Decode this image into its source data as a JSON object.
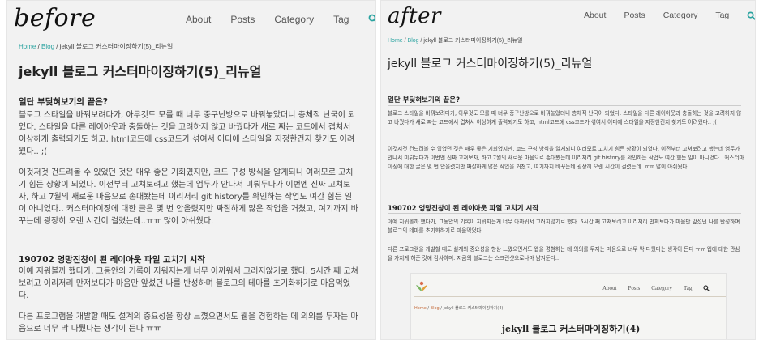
{
  "before": {
    "label": "before",
    "nav": [
      "About",
      "Posts",
      "Category",
      "Tag"
    ],
    "breadcrumb": {
      "home": "Home",
      "sep1": " / ",
      "blog": "Blog",
      "sep2": " / ",
      "current": "jekyll 블로그 커스터마이징하기(5)_리뉴얼"
    },
    "title": "jekyll 블로그 커스터마이징하기(5)_리뉴얼",
    "section1_heading": "일단 부딪혀보기의 끝은?",
    "para1": "블로그 스타일을 바꿔보려다가, 아무것도 모를 때 너무 중구난방으로 바꿔놓았더니 총체적 난국이 되었다. 스타일을 다른 레이아웃과 충돌하는 것을 고려하지 않고 바꿨다가 새로 짜는 코드에서 겹쳐서 이상하게 출력되기도 하고, html코드에 css코드가 섞여서 어디에 스타일을 지정한건지 찾기도 어려웠다.. ;(",
    "para2": "이것저것 건드려볼 수 있었던 것은 매우 좋은 기회였지만, 코드 구성 방식을 알게되니 여러모로 고치기 힘든 상황이 되었다. 이전부터 고쳐보려고 했는데 엄두가 안나서 미뤄두다가 이번엔 진짜 고쳐보자, 하고 7월의 새로운 마음으로 손대봤는데 이리저리 git history를 확인하는 작업도 여간 힘든 일이 아니었다.. 커스터마이징에 대한 글은 몇 번 안올렸지만 짜잘하게 많은 작업을 거쳤고, 여기까지 바꾸는데 굉장히 오랜 시간이 걸렸는데..ㅠㅠ 많이 아쉬웠다.",
    "section2_heading": "190702 엉망진창이 된 레이아웃 파일 고치기 시작",
    "para3": "아예 지워볼까 했다가, 그동안의 기록이 지워지는게 너무 아까워서 그러지않기로 했다. 5시간 째 고쳐보려고 이리저리 만져보다가 마음만 앞섰던 나를 반성하며 블로그의 테마를 초기화하기로 마음먹었다.",
    "para4": "다른 프로그램을 개발할 때도 설계의 중요성을 항상 느꼈으면서도 웹을 경험하는 데 의의를 두자는 마음으로 너무 막 다뤘다는 생각이 든다 ㅠㅠ"
  },
  "after": {
    "label": "after",
    "nav": [
      "About",
      "Posts",
      "Category",
      "Tag"
    ],
    "breadcrumb": {
      "home": "Home",
      "sep1": " / ",
      "blog": "Blog",
      "sep2": " / ",
      "current": "jekyll 블로그 커스터마이징하기(5)_리뉴얼"
    },
    "title": "jekyll 블로그 커스터마이징하기(5)_리뉴얼",
    "section1_heading": "일단 부딪혀보기의 끝은?",
    "para1": "블로그 스타일을 바꿔보려다가, 아무것도 모를 때 너무 중구난방으로 바꿔놓았더니 총체적 난국이 되었다. 스타일을 다른 레이아웃과 충돌하는 것을 고려하지 않고 바꿨다가 새로 짜는 코드에서 겹쳐서 이상하게 출력되기도 하고, html코드에 css코드가 섞여서 어디에 스타일을 지정한건지 찾기도 어려웠다.. ;(",
    "para2": "이것저것 건드려볼 수 있었던 것은 매우 좋은 기회였지만, 코드 구성 방식을 알게되니 여러모로 고치기 힘든 상황이 되었다. 이전부터 고쳐보려고 했는데 엄두가 안나서 미뤄두다가 이번엔 진짜 고쳐보자, 하고 7월의 새로운 마음으로 손대봤는데 이리저리 git history를 확인하는 작업도 여간 힘든 일이 아니었다.. 커스터마이징에 대한 글은 몇 번 안올렸지만 짜잘하게 많은 작업을 거쳤고, 여기까지 바꾸는데 굉장히 오랜 시간이 걸렸는데..ㅠㅠ 많이 아쉬웠다.",
    "section2_heading": "190702 엉망진창이 된 레이아웃 파일 고치기 시작",
    "para3": "아예 지워볼까 했다가, 그동안의 기록이 지워지는게 너무 아까워서 그러지않기로 했다. 5시간 째 고쳐보려고 이리저리 만져보다가 마음만 앞섰던 나를 반성하며 블로그의 테마를 초기화하기로 마음먹었다.",
    "para4": "다른 프로그램을 개발할 때도 설계의 중요성을 항상 느꼈으면서도 웹을 경험하는 데 의의를 두자는 마음으로 너무 막 다뤘다는 생각이 든다 ㅠㅠ 웹에 대한 관심을 가지게 해준 것에 감사하며. 지금의 블로그는 스크린샷으로나마 남겨둔다..",
    "embed": {
      "nav": [
        "About",
        "Posts",
        "Category",
        "Tag"
      ],
      "breadcrumb": {
        "home": "Home",
        "sep1": " / ",
        "blog": "Blog",
        "sep2": " / ",
        "current": "jekyll 블로그 커스터마이징하기(4)"
      },
      "title": "jekyll 블로그 커스터마이징하기(4)"
    }
  },
  "colors": {
    "accent": "#2aa3a0",
    "embed_accent": "#c46b3b",
    "panel_bg": "#f2f2f2"
  },
  "icons": {
    "search": "search-icon"
  }
}
